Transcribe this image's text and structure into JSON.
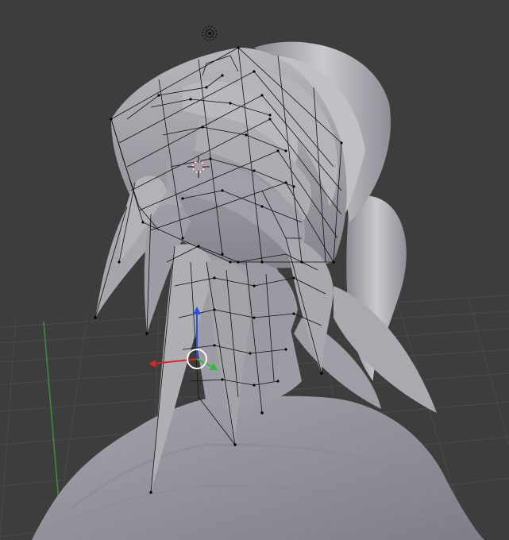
{
  "viewport": {
    "background_color": "#3d3d3d",
    "grid_color": "#4a4a4a",
    "axis_y_color": "#3f8f3f",
    "mesh_color": "#9a9aa2",
    "wire_color": "#111111",
    "vertex_color": "#000000"
  },
  "widgets": {
    "camera_target": "camera-target-icon",
    "cursor_3d": "3d-cursor-icon",
    "manipulator": "transform-manipulator",
    "axis_colors": {
      "x": "#e02424",
      "y": "#2fbf2f",
      "z": "#2a4fe0"
    }
  }
}
